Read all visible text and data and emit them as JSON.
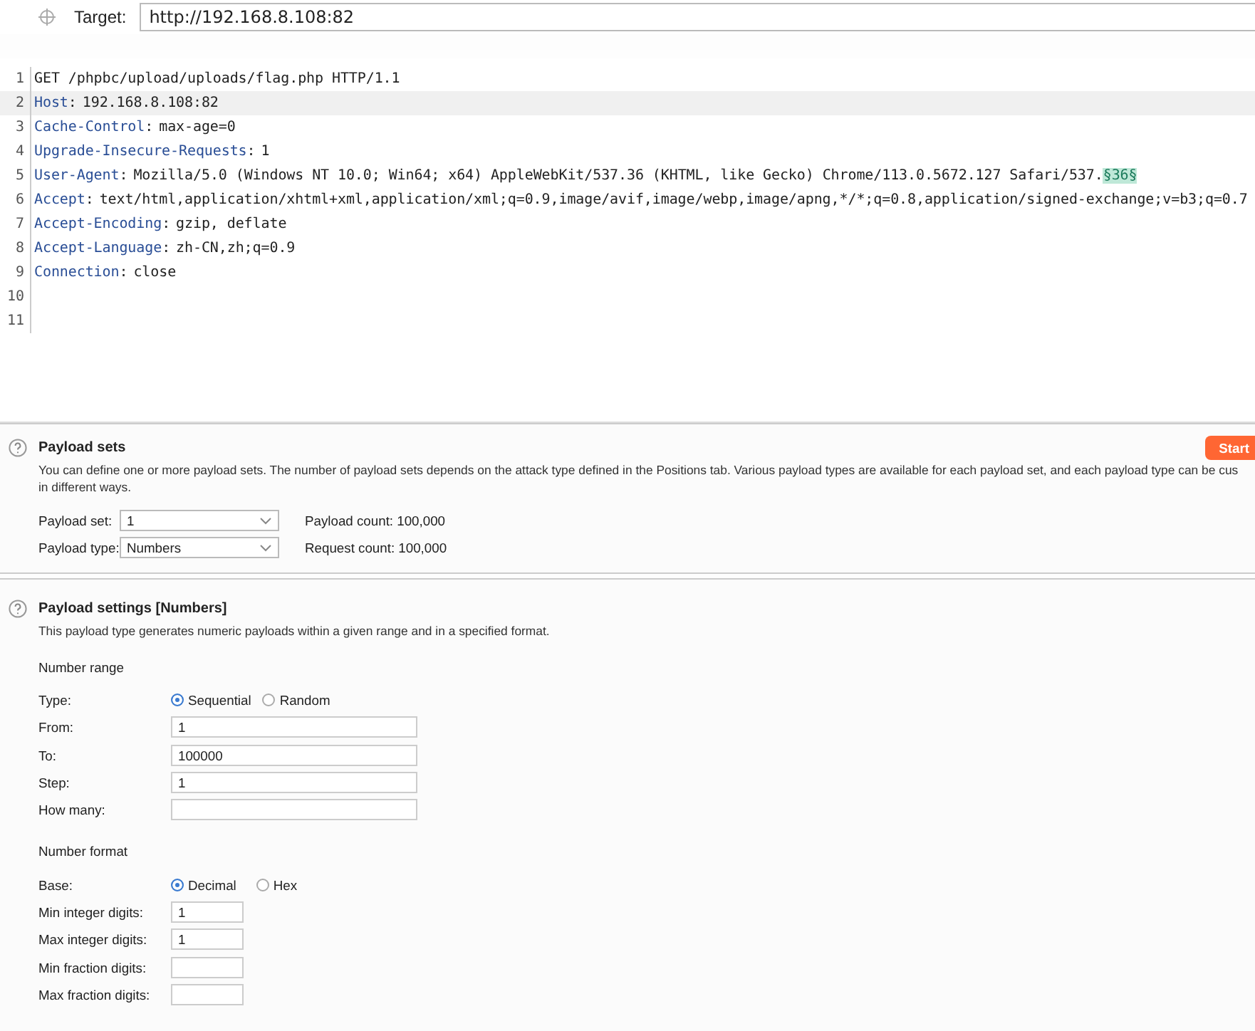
{
  "target": {
    "label": "Target:",
    "value": "http://192.168.8.108:82"
  },
  "request_lines": [
    {
      "number": "1",
      "value": "GET /phpbc/upload/uploads/flag.php HTTP/1.1",
      "selected": false
    },
    {
      "number": "2",
      "key": "Host",
      "separator": ":",
      "value": "192.168.8.108:82",
      "selected": true
    },
    {
      "number": "3",
      "key": "Cache-Control",
      "separator": ":",
      "value": "max-age=0",
      "selected": false
    },
    {
      "number": "4",
      "key": "Upgrade-Insecure-Requests",
      "separator": ":",
      "value": "1",
      "selected": false
    },
    {
      "number": "5",
      "key": "User-Agent",
      "separator": ":",
      "value": "Mozilla/5.0 (Windows NT 10.0; Win64; x64) AppleWebKit/537.36 (KHTML, like Gecko) Chrome/113.0.5672.127 Safari/537.",
      "marker": "§36§",
      "selected": false
    },
    {
      "number": "6",
      "key": "Accept",
      "separator": ":",
      "value": "text/html,application/xhtml+xml,application/xml;q=0.9,image/avif,image/webp,image/apng,*/*;q=0.8,application/signed-exchange;v=b3;q=0.7",
      "selected": false
    },
    {
      "number": "7",
      "key": "Accept-Encoding",
      "separator": ":",
      "value": "gzip, deflate",
      "selected": false
    },
    {
      "number": "8",
      "key": "Accept-Language",
      "separator": ":",
      "value": "zh-CN,zh;q=0.9",
      "selected": false
    },
    {
      "number": "9",
      "key": "Connection",
      "separator": ":",
      "value": "close",
      "selected": false
    },
    {
      "number": "10",
      "selected": false
    },
    {
      "number": "11",
      "selected": false
    }
  ],
  "payload_sets": {
    "title": "Payload sets",
    "start_button": "Start",
    "description": "You can define one or more payload sets. The number of payload sets depends on the attack type defined in the Positions tab. Various payload types are available for each payload set, and each payload type can be cus",
    "description_line_2": "in different ways.",
    "rows": [
      {
        "label": "Payload set:",
        "value": "1",
        "count": "Payload count: 100,000"
      },
      {
        "label": "Payload type:",
        "value": "Numbers",
        "count": "Request count: 100,000"
      }
    ]
  },
  "payload_settings": {
    "title": "Payload settings [Numbers]",
    "description": "This payload type generates numeric payloads within a given range and in a specified format.",
    "groups": [
      {
        "heading": "Number range",
        "rows": [
          {
            "kind": "radio",
            "label": "Type:",
            "options": [
              {
                "label": "Sequential",
                "selected": true
              },
              {
                "label": "Random",
                "selected": false
              }
            ]
          },
          {
            "kind": "field",
            "label": "From:",
            "value": "1"
          },
          {
            "kind": "field",
            "label": "To:",
            "value": "100000"
          },
          {
            "kind": "field",
            "label": "Step:",
            "value": "1"
          },
          {
            "kind": "field",
            "label": "How many:"
          }
        ]
      },
      {
        "heading": "Number format",
        "rows": [
          {
            "kind": "radio",
            "label": "Base:",
            "options": [
              {
                "label": "Decimal",
                "selected": true
              },
              {
                "label": "Hex",
                "selected": false
              }
            ]
          },
          {
            "kind": "short",
            "label": "Min integer digits:",
            "value": "1"
          },
          {
            "kind": "short",
            "label": "Max integer digits:",
            "value": "1"
          },
          {
            "kind": "short",
            "label": "Min fraction digits:"
          },
          {
            "kind": "short",
            "label": "Max fraction digits:"
          }
        ]
      }
    ]
  }
}
